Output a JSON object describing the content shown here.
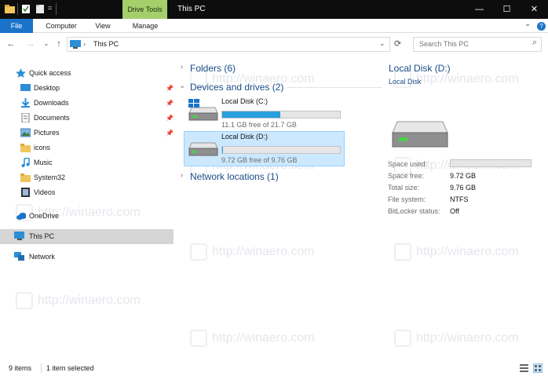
{
  "window": {
    "contextual_tab": "Drive Tools",
    "title": "This PC",
    "min_symbol": "—",
    "max_symbol": "☐",
    "close_symbol": "✕"
  },
  "ribbon": {
    "tabs": [
      "File",
      "Computer",
      "View",
      "Manage"
    ],
    "chevron": "⌄",
    "help": "?"
  },
  "address": {
    "back": "←",
    "forward": "→",
    "recent": "⌄",
    "up": "↑",
    "separator": "›",
    "location": "This PC",
    "dropdown": "⌄",
    "refresh": "⟳",
    "search_placeholder": "Search This PC",
    "search_icon": "⌕"
  },
  "nav": {
    "quick_access": "Quick access",
    "items": [
      {
        "label": "Desktop",
        "pinned": true
      },
      {
        "label": "Downloads",
        "pinned": true
      },
      {
        "label": "Documents",
        "pinned": true
      },
      {
        "label": "Pictures",
        "pinned": true
      },
      {
        "label": "icons",
        "pinned": false
      },
      {
        "label": "Music",
        "pinned": false
      },
      {
        "label": "System32",
        "pinned": false
      },
      {
        "label": "Videos",
        "pinned": false
      }
    ],
    "onedrive": "OneDrive",
    "this_pc": "This PC",
    "network": "Network",
    "pin_glyph": "📌"
  },
  "content": {
    "folders_header": "Folders (6)",
    "devices_header": "Devices and drives (2)",
    "network_header": "Network locations (1)",
    "drives": [
      {
        "name": "Local Disk (C:)",
        "free": "11.1 GB free of 21.7 GB",
        "used_fraction": 0.49
      },
      {
        "name": "Local Disk (D:)",
        "free": "9.72 GB free of 9.76 GB",
        "used_fraction": 0.004
      }
    ]
  },
  "details": {
    "title": "Local Disk (D:)",
    "subtitle": "Local Disk",
    "space_used_label": "Space used:",
    "space_free_label": "Space free:",
    "space_free": "9.72 GB",
    "total_size_label": "Total size:",
    "total_size": "9.76 GB",
    "file_system_label": "File system:",
    "file_system": "NTFS",
    "bitlocker_label": "BitLocker status:",
    "bitlocker": "Off"
  },
  "status": {
    "items": "9 items",
    "selected": "1 item selected"
  },
  "watermark": "http://winaero.com",
  "colors": {
    "accent": "#1a73c8",
    "drive_bar": "#27a0dd",
    "selection": "#cce8ff",
    "header_text": "#1a4c87"
  }
}
